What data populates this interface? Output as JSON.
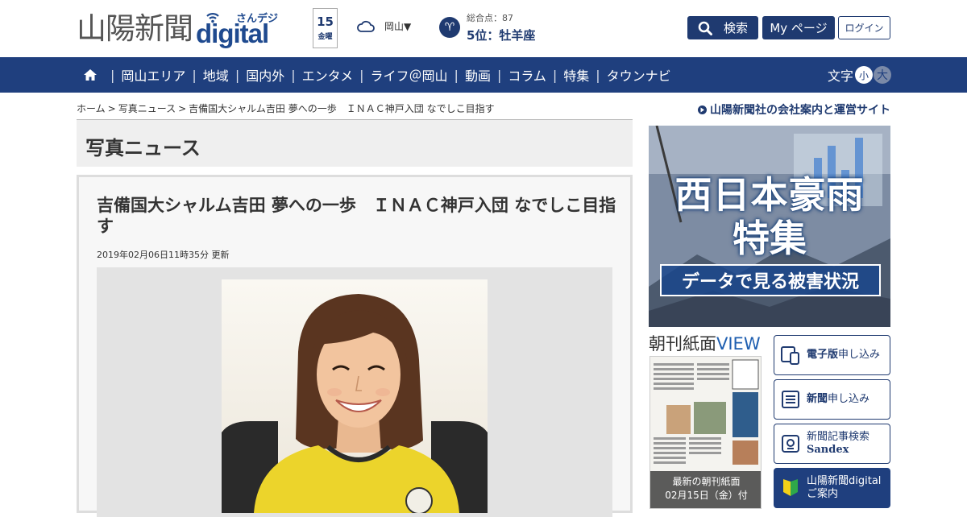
{
  "header": {
    "logo_kanji": "山陽新聞",
    "logo_sandeji": "さんデジ",
    "logo_digital": "digital",
    "date_day": "15",
    "date_weekday": "金曜",
    "weather_location": "岡山▼",
    "horoscope_score": "総合点：87",
    "horoscope_rank": "5位：牡羊座",
    "search_label": "検索",
    "mypage_label": "My ページ",
    "login_label": "ログイン"
  },
  "nav": {
    "items": [
      "岡山エリア",
      "地域",
      "国内外",
      "エンタメ",
      "ライフ＠岡山",
      "動画",
      "コラム",
      "特集",
      "タウンナビ"
    ],
    "font_label": "文字",
    "font_small": "小",
    "font_large": "大"
  },
  "breadcrumb": {
    "home": "ホーム",
    "section": "写真ニュース",
    "current": "吉備国大シャルム吉田 夢への一歩　ＩＮＡＣ神戸入団 なでしこ目指す"
  },
  "section_title": "写真ニュース",
  "article": {
    "title": "吉備国大シャルム吉田 夢への一歩　ＩＮＡＣ神戸入団 なでしこ目指す",
    "updated": "2019年02月06日11時35分 更新"
  },
  "sidebar": {
    "company_link": "山陽新聞社の会社案内と運営サイト",
    "banner_line1": "西日本豪雨",
    "banner_line2": "特集",
    "banner_sub": "データで見る被害状況",
    "view_head_prefix": "朝刊紙面",
    "view_head_suffix": "VIEW",
    "paper_caption_1": "最新の朝刊紙面",
    "paper_caption_2": "02月15日（金）付",
    "buttons": [
      {
        "bold": "電子版",
        "rest": "申し込み"
      },
      {
        "bold": "新聞",
        "rest": "申し込み"
      },
      {
        "line1": "新聞記事検索",
        "line2": "Sandex"
      },
      {
        "line1": "山陽新聞digital",
        "line2": "ご案内"
      }
    ]
  },
  "colors": {
    "brand_navy": "#1f3a70",
    "nav_bg": "#1f3f7e"
  }
}
